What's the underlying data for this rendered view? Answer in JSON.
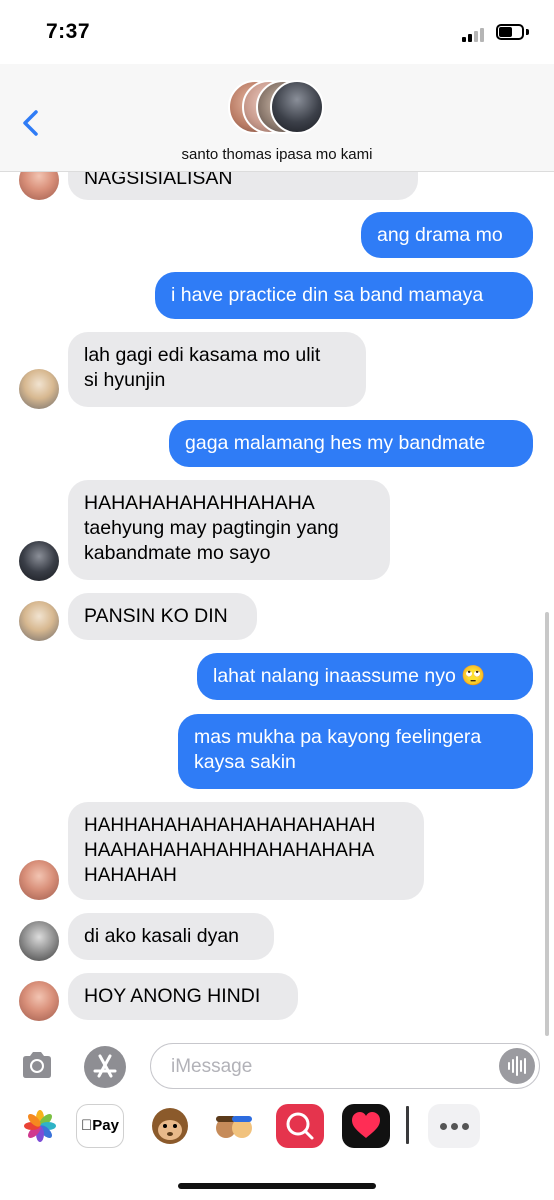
{
  "status": {
    "time": "7:37"
  },
  "header": {
    "group_name": "santo thomas ipasa mo kami"
  },
  "messages": [
    {
      "text": "NAGSISIALISAN"
    },
    {
      "text": "ang drama mo"
    },
    {
      "text": "i have practice din sa band mamaya"
    },
    {
      "text": "lah gagi edi kasama mo ulit\nsi hyunjin"
    },
    {
      "text": "gaga malamang hes my bandmate"
    },
    {
      "text": "HAHAHAHAHAHHAHAHA\ntaehyung may pagtingin yang\nkabandmate mo sayo"
    },
    {
      "text": "PANSIN KO DIN"
    },
    {
      "text": "lahat nalang inaassume nyo 🙄"
    },
    {
      "text": "mas mukha pa kayong feelingera\nkaysa sakin"
    },
    {
      "text": "HAHHAHAHAHAHAHAHAHAHAH\nHAAHAHAHAHAHHAHAHAHAHA\nHAHAHAH"
    },
    {
      "text": "di ako kasali dyan"
    },
    {
      "text": "HOY ANONG HINDI"
    }
  ],
  "composer": {
    "placeholder": "iMessage"
  },
  "drawer": {
    "apple_pay_label": "Pay"
  },
  "colors": {
    "outgoing": "#2f7cf6",
    "incoming": "#e9e9eb",
    "accent": "#2f7cf6"
  },
  "icons": [
    "back-chevron-icon",
    "camera-icon",
    "app-store-icon",
    "audio-waveform-icon",
    "photos-app-icon",
    "apple-pay-icon",
    "memoji-icon",
    "search-app-icon",
    "digital-touch-icon",
    "more-icon"
  ]
}
